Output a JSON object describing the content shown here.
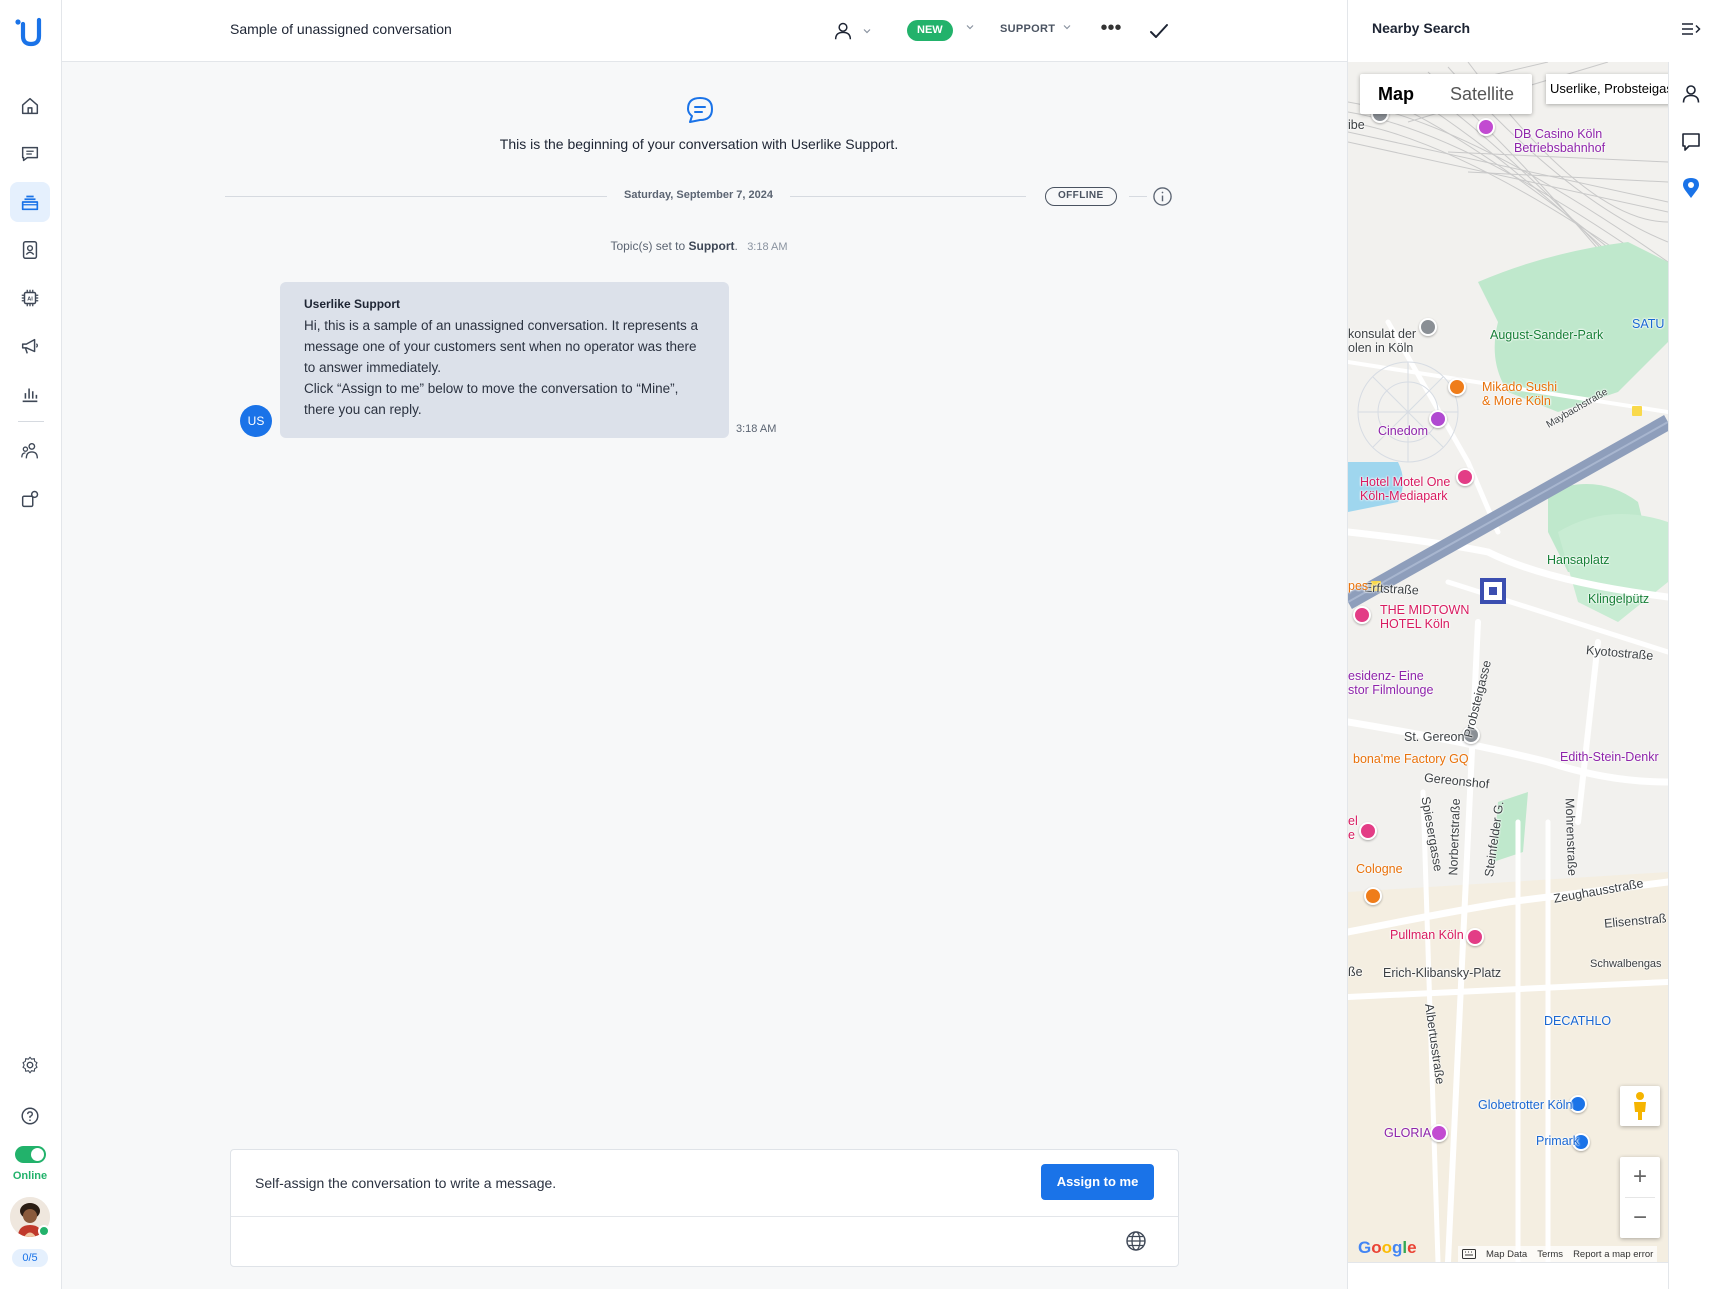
{
  "sidebar": {
    "logo": "userlike-logo-icon",
    "nav": [
      {
        "name": "home-icon",
        "active": false
      },
      {
        "name": "conversations-icon",
        "active": false
      },
      {
        "name": "inbox-stack-icon",
        "active": true
      },
      {
        "name": "contacts-icon",
        "active": false
      },
      {
        "name": "ai-chip-icon",
        "active": false
      },
      {
        "name": "megaphone-icon",
        "active": false
      },
      {
        "name": "analytics-icon",
        "active": false
      },
      {
        "name": "team-icon",
        "active": false
      },
      {
        "name": "integrations-icon",
        "active": false
      },
      {
        "name": "settings-icon",
        "active": false
      },
      {
        "name": "help-icon",
        "active": false
      }
    ],
    "online_label": "Online",
    "capacity": "0/5"
  },
  "topbar": {
    "title": "Sample of unassigned conversation",
    "status": "NEW",
    "topic": "SUPPORT",
    "more": "•••"
  },
  "conversation": {
    "start_text": "This is the beginning of your conversation with Userlike Support.",
    "date": "Saturday, September 7, 2024",
    "offline": "OFFLINE",
    "topic_event_prefix": "Topic(s) set to",
    "topic_event_value": "Support",
    "topic_event_suffix": ".",
    "topic_event_time": "3:18 AM",
    "message": {
      "avatar_initials": "US",
      "sender": "Userlike Support",
      "text": "Hi, this is a sample of an unassigned conversation. It represents a message one of your customers sent when no operator was there to answer immediately.\nClick “Assign to me” below to move the conversation to “Mine”, there you can reply.",
      "time": "3:18 AM"
    }
  },
  "composer": {
    "hint": "Self-assign the conversation to write a message.",
    "assign_label": "Assign to me"
  },
  "right_panel": {
    "title": "Nearby Search",
    "map": {
      "type_map": "Map",
      "type_satellite": "Satellite",
      "search_value": "Userlike, Probsteigasse",
      "google": "Google",
      "map_data": "Map Data",
      "terms": "Terms",
      "report": "Report a map error",
      "labels": {
        "l1": "ibe",
        "l2": "DB Casino Köln\nBetriebsbahnhof",
        "l3": "konsulat der\nolen in Köln",
        "l4": "August-Sander-Park",
        "l5": "SATU",
        "l6": "Mikado Sushi\n& More Köln",
        "l7": "Cinedom",
        "l8": "Maybachstraße",
        "l9": "Hotel Motel One\nKöln-Mediapark",
        "l10": "Hansaplatz",
        "l11": "Erftstraße",
        "l12": "Klingelpütz",
        "l13": "Kyotostraße",
        "l14": "THE MIDTOWN\nHOTEL Köln",
        "l15": "Probsteigasse",
        "l16": "esidenz- Eine\nstor Filmlounge",
        "l17": "St. Gereon",
        "l18": "bona'me Factory GQ",
        "l19": "Edith-Stein-Denkr",
        "l20": "Gereonshof",
        "l21": "Spiesergasse",
        "l22": "Norbertstraße",
        "l23": "Steinfelder G.",
        "l24": "Mohrenstraße",
        "l25": "Cologne",
        "l26": "Zeughausstraße",
        "l27": "Elisenstraß",
        "l28": "Pullman Köln",
        "l29": "Schwalbengas",
        "l30": "ße",
        "l31": "Erich-Klibansky-Platz",
        "l32": "Albertusstraße",
        "l33": "DECATHLO",
        "l34": "Globetrotter Köln",
        "l35": "GLORIA",
        "l36": "Primark",
        "l37": "pes",
        "l38": "el\ne"
      }
    }
  }
}
